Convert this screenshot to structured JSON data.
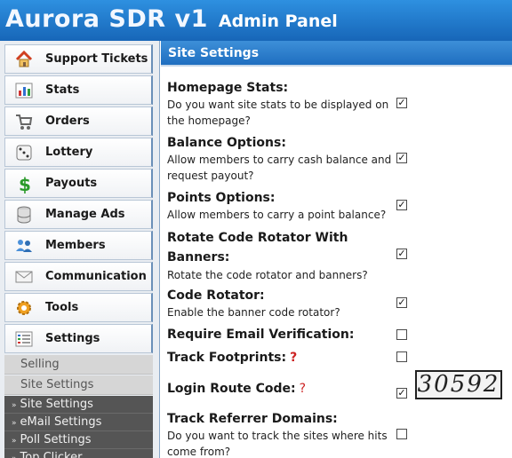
{
  "header": {
    "title": "Aurora SDR v1",
    "subtitle": "Admin Panel"
  },
  "sidebar": {
    "items": [
      {
        "label": "Support Tickets",
        "icon": "house-icon"
      },
      {
        "label": "Stats",
        "icon": "bar-chart-icon"
      },
      {
        "label": "Orders",
        "icon": "shopping-cart-icon"
      },
      {
        "label": "Lottery",
        "icon": "dice-icon"
      },
      {
        "label": "Payouts",
        "icon": "dollar-icon"
      },
      {
        "label": "Manage Ads",
        "icon": "database-icon"
      },
      {
        "label": "Members",
        "icon": "users-icon"
      },
      {
        "label": "Communication",
        "icon": "envelope-icon"
      },
      {
        "label": "Tools",
        "icon": "gear-icon"
      },
      {
        "label": "Settings",
        "icon": "settings-list-icon"
      }
    ],
    "sub_items": [
      "Selling",
      "Site Settings"
    ],
    "settings_links": [
      "Site Settings",
      "eMail Settings",
      "Poll Settings",
      "Top Clicker"
    ]
  },
  "main": {
    "title": "Site Settings",
    "settings": [
      {
        "title": "Homepage Stats:",
        "description": "Do you want site stats to be displayed on the homepage?",
        "checked": true
      },
      {
        "title": "Balance Options:",
        "description": "Allow members to carry cash balance and request payout?",
        "checked": true
      },
      {
        "title": "Points Options:",
        "description": "Allow members to carry a point balance?",
        "checked": true
      },
      {
        "title": "Rotate Code Rotator With Banners:",
        "description": "Rotate the code rotator and banners?",
        "checked": true
      },
      {
        "title": "Code Rotator:",
        "description": "Enable the banner code rotator?",
        "checked": true
      },
      {
        "title": "Require Email Verification:",
        "description": "",
        "checked": false
      },
      {
        "title": "Track Footprints:",
        "description": "",
        "help": "?",
        "checked": false
      },
      {
        "title": "Login Route Code:",
        "description": "",
        "help": "?",
        "checked": true,
        "captcha": "30592"
      },
      {
        "title": "Track Referrer Domains:",
        "description": "Do you want to track the sites where hits come from?",
        "checked": false
      }
    ],
    "check_mark": "✓"
  },
  "colors": {
    "header_blue": "#1f6ec0",
    "help_red": "#cc2222",
    "dark_submenu": "#555555"
  }
}
